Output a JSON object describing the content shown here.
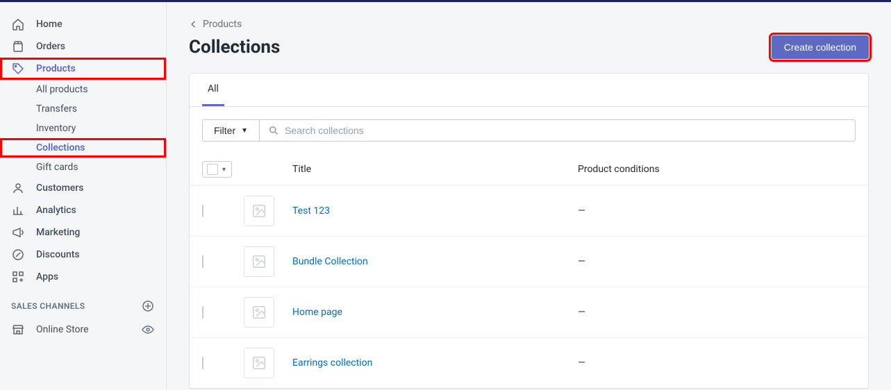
{
  "sidebar": {
    "items": [
      {
        "label": "Home"
      },
      {
        "label": "Orders"
      },
      {
        "label": "Products"
      },
      {
        "label": "Customers"
      },
      {
        "label": "Analytics"
      },
      {
        "label": "Marketing"
      },
      {
        "label": "Discounts"
      },
      {
        "label": "Apps"
      }
    ],
    "product_sub": [
      {
        "label": "All products"
      },
      {
        "label": "Transfers"
      },
      {
        "label": "Inventory"
      },
      {
        "label": "Collections"
      },
      {
        "label": "Gift cards"
      }
    ],
    "channels_header": "SALES CHANNELS",
    "channels": [
      {
        "label": "Online Store"
      }
    ]
  },
  "breadcrumb": {
    "back": "Products"
  },
  "header": {
    "title": "Collections",
    "create_btn": "Create collection"
  },
  "tabs": [
    {
      "label": "All"
    }
  ],
  "filter": {
    "btn": "Filter",
    "search_placeholder": "Search collections"
  },
  "table": {
    "headers": {
      "title": "Title",
      "conditions": "Product conditions"
    },
    "rows": [
      {
        "title": "Test 123",
        "conditions": "—"
      },
      {
        "title": "Bundle Collection",
        "conditions": "—"
      },
      {
        "title": "Home page",
        "conditions": "—"
      },
      {
        "title": "Earrings collection",
        "conditions": "—"
      }
    ]
  }
}
